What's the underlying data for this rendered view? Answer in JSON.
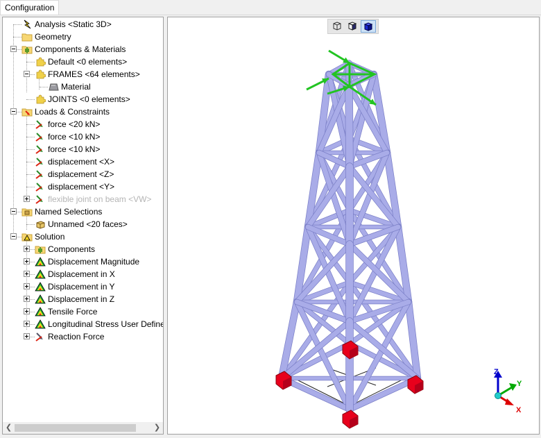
{
  "tabs": [
    {
      "label": "Configuration"
    }
  ],
  "tree": {
    "items": [
      {
        "label": "Analysis <Static 3D>",
        "icon": "lightning-icon"
      },
      {
        "label": "Geometry",
        "icon": "folder-icon"
      },
      {
        "label": "Components & Materials",
        "icon": "components-icon"
      },
      {
        "label": "Default <0 elements>",
        "icon": "puzzle-icon"
      },
      {
        "label": "FRAMES <64 elements>",
        "icon": "puzzle-icon"
      },
      {
        "label": "Material",
        "icon": "material-icon"
      },
      {
        "label": "JOINTS <0 elements>",
        "icon": "puzzle-icon"
      },
      {
        "label": "Loads & Constraints",
        "icon": "loads-icon"
      },
      {
        "label": "force <20 kN>",
        "icon": "force-icon"
      },
      {
        "label": "force <10 kN>",
        "icon": "force-icon"
      },
      {
        "label": "force <10 kN>",
        "icon": "force-icon"
      },
      {
        "label": "displacement <X>",
        "icon": "displacement-icon"
      },
      {
        "label": "displacement <Z>",
        "icon": "displacement-icon"
      },
      {
        "label": "displacement <Y>",
        "icon": "displacement-icon"
      },
      {
        "label": "flexible joint on beam <VW>",
        "icon": "flexible-joint-icon"
      },
      {
        "label": "Named Selections",
        "icon": "selection-folder-icon"
      },
      {
        "label": "Unnamed <20 faces>",
        "icon": "faces-icon"
      },
      {
        "label": "Solution",
        "icon": "solution-icon"
      },
      {
        "label": "Components",
        "icon": "components-icon"
      },
      {
        "label": "Displacement Magnitude",
        "icon": "result-icon"
      },
      {
        "label": "Displacement in X",
        "icon": "result-icon"
      },
      {
        "label": "Displacement in Y",
        "icon": "result-icon"
      },
      {
        "label": "Displacement in Z",
        "icon": "result-icon"
      },
      {
        "label": "Tensile Force",
        "icon": "result-icon"
      },
      {
        "label": "Longitudinal Stress User Defined",
        "icon": "result-icon"
      },
      {
        "label": "Reaction Force",
        "icon": "reaction-icon"
      }
    ]
  },
  "viewport": {
    "view_buttons": [
      {
        "name": "wireframe-view-icon"
      },
      {
        "name": "shaded-view-icon"
      },
      {
        "name": "shaded-edges-view-icon",
        "active": true
      }
    ],
    "triad": {
      "x": "X",
      "y": "Y",
      "z": "Z"
    },
    "colors": {
      "beam": "#a9ace8",
      "force": "#22c422",
      "support": "#e8001c"
    }
  }
}
